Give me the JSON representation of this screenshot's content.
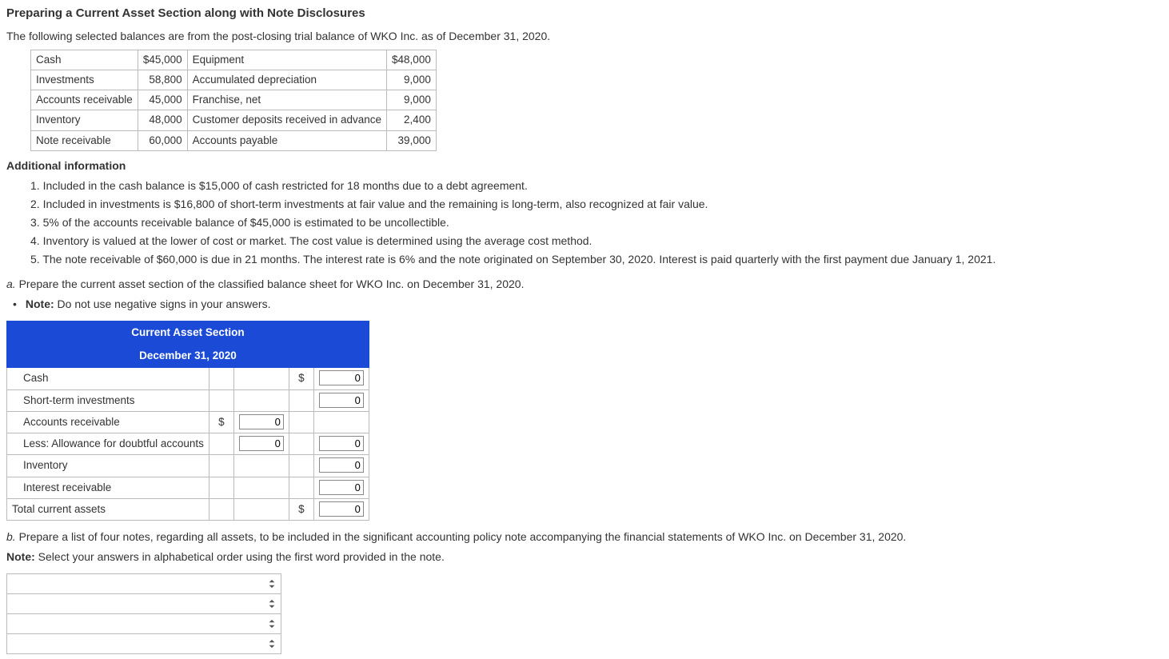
{
  "title": "Preparing a Current Asset Section along with Note Disclosures",
  "intro": "The following selected balances are from the post-closing trial balance of WKO Inc. as of December 31, 2020.",
  "balances": [
    {
      "l1": "Cash",
      "v1": "$45,000",
      "l2": "Equipment",
      "v2": "$48,000"
    },
    {
      "l1": "Investments",
      "v1": "58,800",
      "l2": "Accumulated depreciation",
      "v2": "9,000"
    },
    {
      "l1": "Accounts receivable",
      "v1": "45,000",
      "l2": "Franchise, net",
      "v2": "9,000"
    },
    {
      "l1": "Inventory",
      "v1": "48,000",
      "l2": "Customer deposits received in advance",
      "v2": "2,400"
    },
    {
      "l1": "Note receivable",
      "v1": "60,000",
      "l2": "Accounts payable",
      "v2": "39,000"
    }
  ],
  "additional_heading": "Additional information",
  "additional": [
    "1. Included in the cash balance is $15,000 of cash restricted for 18 months due to a debt agreement.",
    "2. Included in investments is $16,800 of short-term investments at fair value and the remaining is long-term, also recognized at fair value.",
    "3. 5% of the accounts receivable balance of $45,000 is estimated to be uncollectible.",
    "4. Inventory is valued at the lower of cost or market. The cost value is determined using the average cost method.",
    "5. The note receivable of $60,000 is due in 21 months. The interest rate is 6% and the note originated on September 30, 2020. Interest is paid quarterly with the first payment due January 1, 2021."
  ],
  "qa_prefix": "a.",
  "qa_text": " Prepare the current asset section of the classified balance sheet for WKO Inc. on December 31, 2020.",
  "note_prefix": "Note:",
  "note_text": " Do not use negative signs in your answers.",
  "cas": {
    "header1": "Current Asset Section",
    "header2": "December 31, 2020",
    "rows": {
      "cash": "Cash",
      "sti": "Short-term investments",
      "ar": "Accounts receivable",
      "allowance": "Less: Allowance for doubtful accounts",
      "inventory": "Inventory",
      "interest": "Interest receivable",
      "total": "Total current assets"
    },
    "dollar": "$",
    "zero": "0"
  },
  "qb_prefix": "b.",
  "qb_text": " Prepare a list of four notes, regarding all assets, to be included in the significant accounting policy note accompanying the financial statements of WKO Inc. on December 31, 2020.",
  "note2_prefix": "Note:",
  "note2_text": " Select your answers in alphabetical order using the first word provided in the note."
}
